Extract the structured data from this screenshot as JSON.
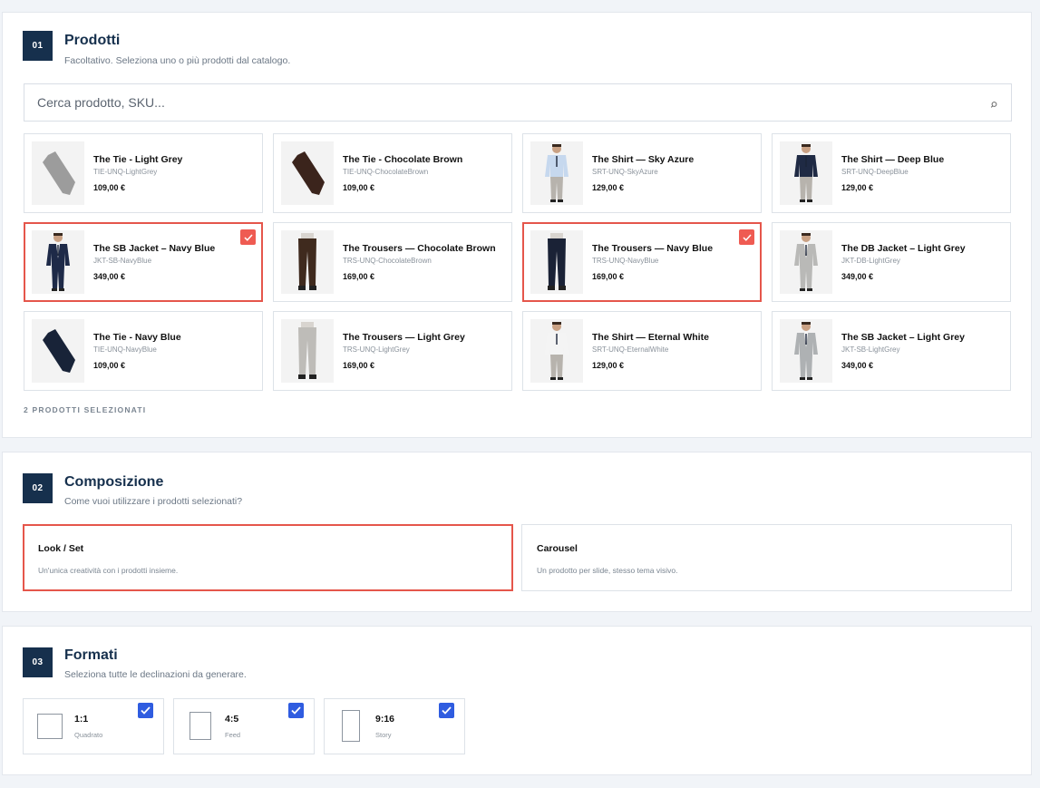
{
  "section1": {
    "number": "01",
    "title": "Prodotti",
    "subtitle": "Facoltativo. Seleziona uno o più prodotti dal catalogo.",
    "search_placeholder": "Cerca prodotto, SKU...",
    "selected_count": "2 PRODOTTI SELEZIONATI",
    "products": [
      {
        "name": "The Tie - Light Grey",
        "sku": "TIE-UNQ-LightGrey",
        "price": "109,00 €",
        "selected": false,
        "image": "tie-light-grey"
      },
      {
        "name": "The Tie - Chocolate Brown",
        "sku": "TIE-UNQ-ChocolateBrown",
        "price": "109,00 €",
        "selected": false,
        "image": "tie-chocolate-brown"
      },
      {
        "name": "The Shirt — Sky Azure",
        "sku": "SRT-UNQ-SkyAzure",
        "price": "129,00 €",
        "selected": false,
        "image": "model-shirt-sky-azure"
      },
      {
        "name": "The Shirt — Deep Blue",
        "sku": "SRT-UNQ-DeepBlue",
        "price": "129,00 €",
        "selected": false,
        "image": "model-shirt-deep-blue"
      },
      {
        "name": "The SB Jacket – Navy Blue",
        "sku": "JKT-SB-NavyBlue",
        "price": "349,00 €",
        "selected": true,
        "image": "model-jacket-navy"
      },
      {
        "name": "The Trousers — Chocolate Brown",
        "sku": "TRS-UNQ-ChocolateBrown",
        "price": "169,00 €",
        "selected": false,
        "image": "trousers-chocolate-brown"
      },
      {
        "name": "The Trousers — Navy Blue",
        "sku": "TRS-UNQ-NavyBlue",
        "price": "169,00 €",
        "selected": true,
        "image": "trousers-navy-blue"
      },
      {
        "name": "The DB Jacket – Light Grey",
        "sku": "JKT-DB-LightGrey",
        "price": "349,00 €",
        "selected": false,
        "image": "model-jacket-light-grey"
      },
      {
        "name": "The Tie - Navy Blue",
        "sku": "TIE-UNQ-NavyBlue",
        "price": "109,00 €",
        "selected": false,
        "image": "tie-navy-blue"
      },
      {
        "name": "The Trousers — Light Grey",
        "sku": "TRS-UNQ-LightGrey",
        "price": "169,00 €",
        "selected": false,
        "image": "trousers-light-grey"
      },
      {
        "name": "The Shirt — Eternal White",
        "sku": "SRT-UNQ-EternalWhite",
        "price": "129,00 €",
        "selected": false,
        "image": "model-shirt-white"
      },
      {
        "name": "The SB Jacket – Light Grey",
        "sku": "JKT-SB-LightGrey",
        "price": "349,00 €",
        "selected": false,
        "image": "model-jacket-sb-light-grey"
      }
    ]
  },
  "section2": {
    "number": "02",
    "title": "Composizione",
    "subtitle": "Come vuoi utilizzare i prodotti selezionati?",
    "options": [
      {
        "title": "Look / Set",
        "desc": "Un'unica creatività con i prodotti insieme.",
        "selected": true
      },
      {
        "title": "Carousel",
        "desc": "Un prodotto per slide, stesso tema visivo.",
        "selected": false
      }
    ]
  },
  "section3": {
    "number": "03",
    "title": "Formati",
    "subtitle": "Seleziona tutte le declinazioni da generare.",
    "formats": [
      {
        "ratio": "1:1",
        "label": "Quadrato",
        "checked": true
      },
      {
        "ratio": "4:5",
        "label": "Feed",
        "checked": true
      },
      {
        "ratio": "9:16",
        "label": "Story",
        "checked": true
      }
    ]
  },
  "colors": {
    "badge": "#16304d",
    "selected_border": "#e5564b",
    "check_red": "#ef5b52",
    "check_blue": "#2f5ce0"
  },
  "icons": {
    "search": "search-icon",
    "check": "check-icon"
  }
}
